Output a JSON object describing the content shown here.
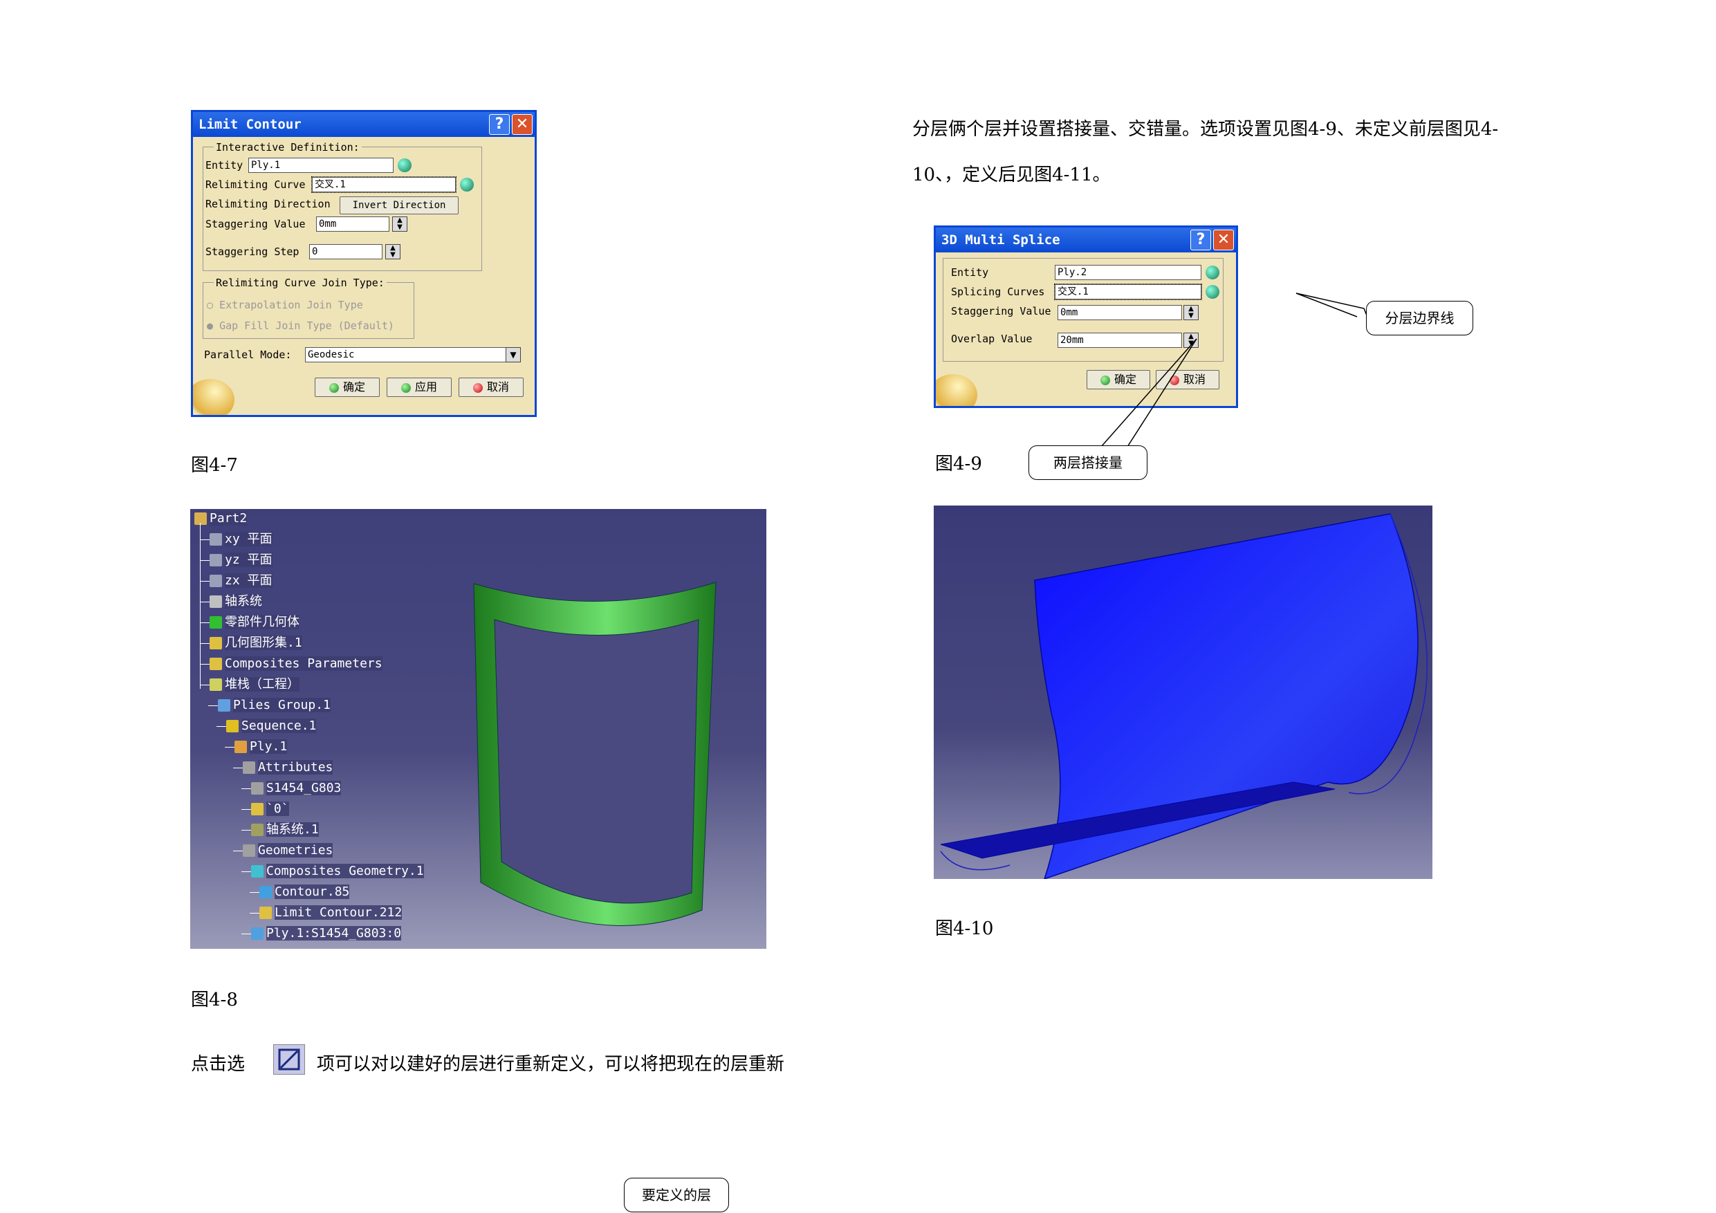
{
  "text_right_top_line1": "分层俩个层并设置搭接量、交错量。选项设置见图4-9、未定义前层图见4-",
  "text_right_top_line2": "10、，定义后见图4-11。",
  "limit_contour": {
    "title": "Limit Contour",
    "help": "?",
    "close": "✕",
    "group_interactive": "Interactive Definition:",
    "entity_label": "Entity",
    "entity_value": "Ply.1",
    "relimiting_curve_label": "Relimiting Curve",
    "relimiting_curve_value": "交叉.1",
    "relimiting_direction_label": "Relimiting Direction",
    "invert_direction": "Invert Direction",
    "staggering_value_label": "Staggering Value",
    "staggering_value": "0mm",
    "staggering_step_label": "Staggering Step",
    "staggering_step": "0",
    "group_join": "Relimiting Curve Join Type:",
    "opt_extrapolation": "Extrapolation Join Type",
    "opt_gapfill": "Gap Fill Join Type (Default)",
    "parallel_mode_label": "Parallel Mode:",
    "parallel_mode_value": "Geodesic",
    "ok": "确定",
    "apply": "应用",
    "cancel": "取消"
  },
  "caption_47": "图4-7",
  "multi_splice": {
    "title": "3D Multi Splice",
    "help": "?",
    "close": "✕",
    "entity_label": "Entity",
    "entity_value": "Ply.2",
    "splicing_curves_label": "Splicing Curves",
    "splicing_curves_value": "交叉.1",
    "staggering_value_label": "Staggering Value",
    "staggering_value": "0mm",
    "overlap_value_label": "Overlap Value",
    "overlap_value": "20mm",
    "ok": "确定",
    "cancel": "取消"
  },
  "callout_boundary": "分层边界线",
  "caption_49": "图4-9",
  "callout_overlap": "两层搭接量",
  "tree": [
    {
      "label": "Part2",
      "x": 0,
      "y": 0
    },
    {
      "label": "xy 平面",
      "x": 1,
      "y": 1
    },
    {
      "label": "yz 平面",
      "x": 1,
      "y": 2
    },
    {
      "label": "zx 平面",
      "x": 1,
      "y": 3
    },
    {
      "label": "轴系统",
      "x": 1,
      "y": 4
    },
    {
      "label": "零部件几何体",
      "x": 1,
      "y": 5
    },
    {
      "label": "几何图形集.1",
      "x": 1,
      "y": 6
    },
    {
      "label": "Composites Parameters",
      "x": 1,
      "y": 7
    },
    {
      "label": "堆栈（工程）",
      "x": 1,
      "y": 8
    },
    {
      "label": "Plies Group.1",
      "x": 2,
      "y": 9
    },
    {
      "label": "Sequence.1",
      "x": 3,
      "y": 10
    },
    {
      "label": "Ply.1",
      "x": 4,
      "y": 11
    },
    {
      "label": "Attributes",
      "x": 5,
      "y": 12
    },
    {
      "label": "S1454_G803",
      "x": 6,
      "y": 13
    },
    {
      "label": "`0`",
      "x": 6,
      "y": 14
    },
    {
      "label": "轴系统.1",
      "x": 6,
      "y": 15
    },
    {
      "label": "Geometries",
      "x": 5,
      "y": 16
    },
    {
      "label": "Composites Geometry.1",
      "x": 6,
      "y": 17
    },
    {
      "label": "Contour.85",
      "x": 7,
      "y": 18
    },
    {
      "label": "Limit Contour.212",
      "x": 7,
      "y": 19
    },
    {
      "label": "Ply.1:S1454_G803:0",
      "x": 6,
      "y": 20
    }
  ],
  "caption_410": "图4-10",
  "caption_48": "图4-8",
  "text_bottom_before": "点击选",
  "text_bottom_after": "项可以对以建好的层进行重新定义，可以将把现在的层重新",
  "callout_define": "要定义的层",
  "colors": {
    "title_blue": "#0b49d3",
    "tree_bg": "#3f3f7a",
    "green_part": "#2a9a2a",
    "blue_part": "#1e1ef0"
  }
}
